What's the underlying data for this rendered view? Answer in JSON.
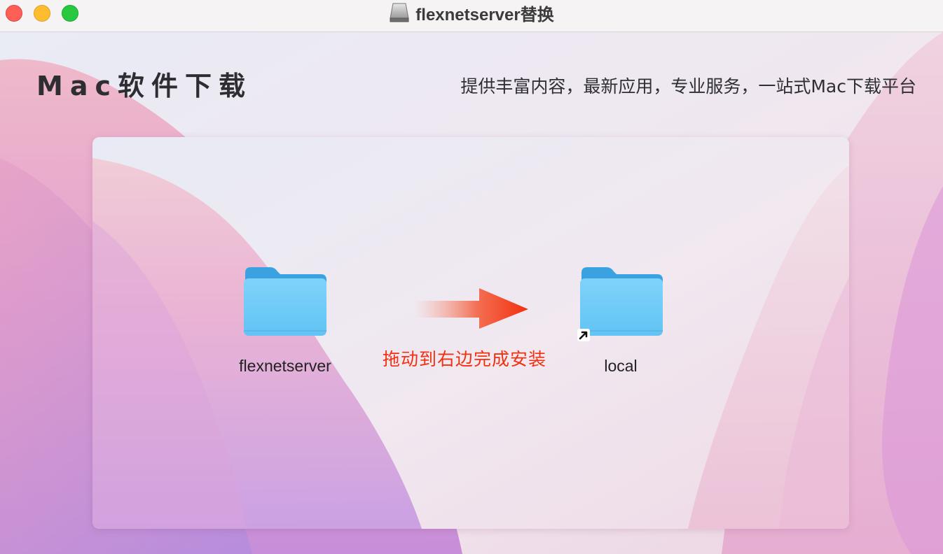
{
  "window": {
    "title": "flexnetserver替换",
    "controls": [
      "close",
      "minimize",
      "zoom"
    ],
    "title_icon": "disk-image-icon"
  },
  "header": {
    "brand": "Mac软件下载",
    "tagline": "提供丰富内容，最新应用，专业服务，一站式Mac下载平台"
  },
  "installer": {
    "source": {
      "label": "flexnetserver",
      "icon": "folder-icon"
    },
    "target": {
      "label": "local",
      "icon": "folder-alias-icon"
    },
    "instruction": "拖动到右边完成安装",
    "arrow_icon": "right-arrow-icon"
  },
  "colors": {
    "accent_red": "#f2300f",
    "folder_blue": "#6fcbf7",
    "folder_tab": "#3aa2e0"
  }
}
